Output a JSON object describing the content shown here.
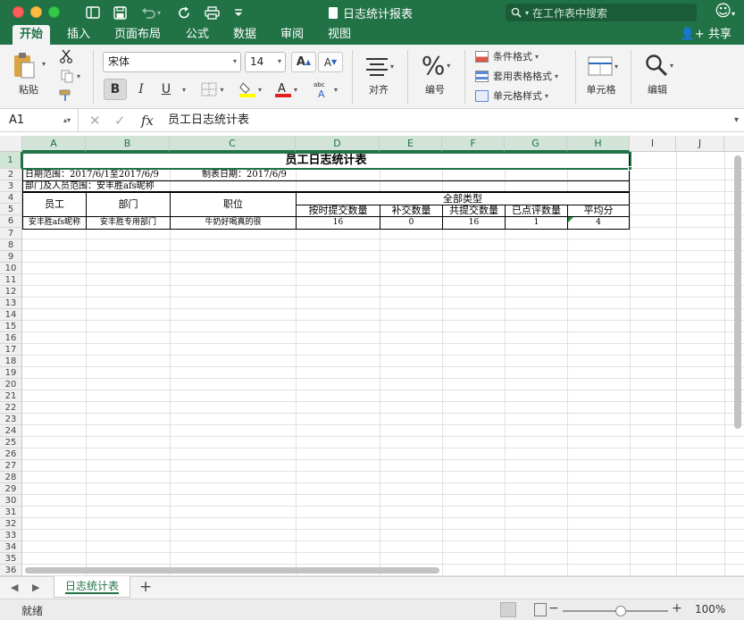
{
  "window": {
    "title": "日志统计报表",
    "search_placeholder": "在工作表中搜索"
  },
  "tabs": [
    "开始",
    "插入",
    "页面布局",
    "公式",
    "数据",
    "审阅",
    "视图"
  ],
  "share_label": "共享",
  "ribbon": {
    "paste_label": "粘贴",
    "font_name": "宋体",
    "font_size": "14",
    "bold": "B",
    "italic": "I",
    "underline": "U",
    "align_label": "对齐",
    "number_label": "编号",
    "number_symbol": "%",
    "cond_format": "条件格式",
    "table_format": "套用表格格式",
    "cell_style": "单元格样式",
    "cells_label": "单元格",
    "edit_label": "编辑"
  },
  "formula_bar": {
    "name_box": "A1",
    "fx": "fx",
    "content": "员工日志统计表"
  },
  "columns": [
    "A",
    "B",
    "C",
    "D",
    "E",
    "F",
    "G",
    "H",
    "I",
    "J"
  ],
  "rows": [
    "1",
    "2",
    "3",
    "4",
    "5",
    "6",
    "7",
    "8",
    "9",
    "10",
    "11",
    "12",
    "13",
    "14",
    "15",
    "16",
    "17",
    "18",
    "19",
    "20",
    "21",
    "22",
    "23",
    "24",
    "25",
    "26",
    "27",
    "28",
    "29",
    "30",
    "31",
    "32",
    "33",
    "34",
    "35",
    "36"
  ],
  "sheet": {
    "title": "员工日志统计表",
    "date_range": "日期范围：2017/6/1至2017/6/9",
    "made_date": "制表日期：2017/6/9",
    "dept_scope": "部门及人员范围：安丰胜afs昵称",
    "all_types": "全部类型",
    "headers": {
      "employee": "员工",
      "dept": "部门",
      "position": "职位",
      "ontime": "按时提交数量",
      "makeup": "补交数量",
      "total": "共提交数量",
      "reviewed": "已点评数量",
      "avg": "平均分"
    },
    "row6": {
      "employee": "安丰胜afs昵称",
      "dept": "安丰胜专用部门",
      "position": "牛奶好喝真的很",
      "ontime": "16",
      "makeup": "0",
      "total": "16",
      "reviewed": "1",
      "avg": "4"
    }
  },
  "sheet_tab": "日志统计表",
  "status": {
    "ready": "就绪",
    "zoom": "100%",
    "zoom_minus": "−",
    "zoom_plus": "+"
  },
  "colors": {
    "accent": "#217346"
  }
}
